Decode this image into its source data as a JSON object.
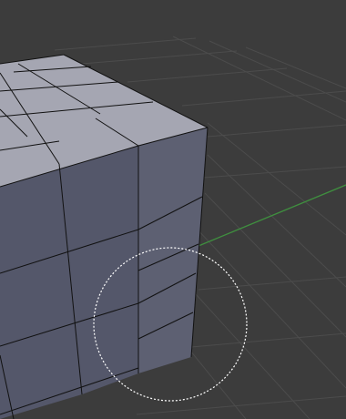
{
  "viewport": {
    "background_color": "#3c3c3c",
    "grid_color": "#4d4d4d",
    "x_axis_color": "#3f8f3f"
  },
  "mesh": {
    "object": "cube",
    "top_face_color": "#a5a6b2",
    "front_face_color": "#545767",
    "side_face_color": "#5e6172",
    "edge_color": "#101010",
    "subdivisions": 4
  },
  "tool": {
    "name": "brush-radius-circle",
    "stroke_color": "#ffffff"
  }
}
